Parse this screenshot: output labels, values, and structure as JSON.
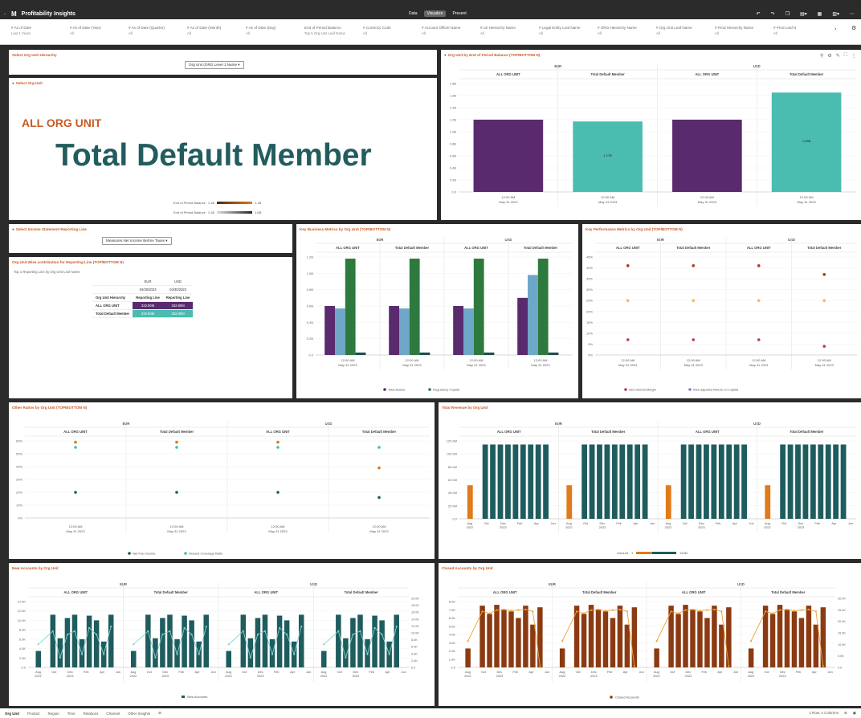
{
  "app": {
    "title": "Profitability Insights",
    "logo": "M",
    "nav_modes": [
      "Data",
      "Visualize",
      "Present"
    ],
    "active_mode": "Visualize"
  },
  "toolbar_icons": [
    "back-icon",
    "undo-icon",
    "redo-icon",
    "bookmark-icon",
    "save-icon",
    "grid-icon",
    "export-icon",
    "menu-icon"
  ],
  "filters": [
    {
      "label": "# As of Date",
      "value": "Last 1 Years"
    },
    {
      "label": "# As of Date (Year)",
      "value": "All"
    },
    {
      "label": "# As of Date (Quarter)",
      "value": "All"
    },
    {
      "label": "# As of Date (Month)",
      "value": "All"
    },
    {
      "label": "# As of Date (Day)",
      "value": "All"
    },
    {
      "label": "End of Period Balance",
      "value": "Top 5 Org Unit Leaf Name"
    },
    {
      "label": "# Currency Code",
      "value": "All"
    },
    {
      "label": "# Account Officer Name",
      "value": "All"
    },
    {
      "label": "# LE Hierarchy Name",
      "value": "All"
    },
    {
      "label": "# Legal Entity Leaf Name",
      "value": "All"
    },
    {
      "label": "# ORG Hierarchy Name",
      "value": "All"
    },
    {
      "label": "# Org Unit Leaf Name",
      "value": "All"
    },
    {
      "label": "# Prod Hierarchy Name",
      "value": "All"
    },
    {
      "label": "# Prod Leaf N",
      "value": "All"
    }
  ],
  "org_hier": {
    "title": "Select Org Unit Hierarchy",
    "select": "Org Unit (ORG Level 1 Name"
  },
  "select_org": {
    "title": "Select Org Unit",
    "parent": "ALL ORG UNIT",
    "member": "Total Default Member",
    "legend": [
      {
        "label": "End of Period Balance",
        "min": "1.1B",
        "max": "1.1B"
      },
      {
        "label": "End of Period Balance",
        "min": "1.1B",
        "max": "1.6B"
      }
    ]
  },
  "reporting_line": {
    "title": "Select Income Statement Reporting Line",
    "select": "Measures.Net Income Before Taxes"
  },
  "contrib": {
    "title": "Org Unit Wise contribution for Reporting Line (TOP/BOTTOM N)",
    "subtitle": "Top 1 Reporting Line by Org Unit Leaf Name",
    "currencies": [
      "EUR",
      "USD"
    ],
    "dates": [
      "04/30/2023",
      "04/30/2023"
    ],
    "header_row": [
      "Org Unit Hierarchy",
      "Reporting Line",
      "Reporting Line"
    ],
    "rows": [
      {
        "name": "ALL ORG UNIT",
        "vals": [
          "332.90M",
          "332.90M"
        ]
      },
      {
        "name": "Total Default Member",
        "vals": [
          "332.90M",
          "332.90M"
        ]
      }
    ]
  },
  "eop": {
    "title": "Org Unit by End of Period Balance (TOP/BOTTOM N)",
    "currencies": [
      "EUR",
      "USD"
    ],
    "columns": [
      "ALL ORG UNIT",
      "Total Default Member",
      "ALL ORG UNIT",
      "Total Default Member"
    ],
    "x_label_1": "12:00 AM",
    "x_label_2": "May 31 2023",
    "y_ticks": [
      "1.8B",
      "1.6B",
      "1.4B",
      "1.2B",
      "1.0B",
      "0.8B",
      "0.6B",
      "0.4B",
      "0.2B",
      "0.0"
    ],
    "bar_labels": [
      "",
      "1.17B",
      "",
      "1.65B"
    ]
  },
  "key_business": {
    "title": "Key Business Metrics by Org Unit (TOP/BOTTOM N)",
    "currencies": [
      "EUR",
      "USD"
    ],
    "columns": [
      "ALL ORG UNIT",
      "Total Default Member",
      "ALL ORG UNIT",
      "Total Default Member"
    ],
    "y_ticks": [
      "1.2B",
      "1.0B",
      "0.8B",
      "0.6B",
      "0.4B",
      "0.2B",
      "0.0"
    ],
    "legend": [
      "Total Assets",
      "Regulatory Capital"
    ]
  },
  "key_perf": {
    "title": "Key Performance Metrics by Org Unit (TOP/BOTTOM N)",
    "currencies": [
      "EUR",
      "USD"
    ],
    "columns": [
      "ALL ORG UNIT",
      "Total Default Member",
      "ALL ORG UNIT",
      "Total Default Member"
    ],
    "y_ticks": [
      "45%",
      "40%",
      "35%",
      "30%",
      "25%",
      "20%",
      "15%",
      "10%",
      "5%",
      "0%"
    ],
    "legend": [
      "Net Interest Margin",
      "Risk adjusted Return on Capital"
    ]
  },
  "other_ratios": {
    "title": "Other Ratios by Org Unit (TOP/BOTTOM N)",
    "currencies": [
      "EUR",
      "USD"
    ],
    "columns": [
      "ALL ORG UNIT",
      "Total Default Member",
      "ALL ORG UNIT",
      "Total Default Member"
    ],
    "y_ticks": [
      "60%",
      "50%",
      "40%",
      "30%",
      "20%",
      "10%",
      "0%"
    ],
    "legend": [
      "Net Fee Income",
      "Interest Coverage Ratio"
    ]
  },
  "revenue": {
    "title": "Total Revenue by Org Unit",
    "currencies": [
      "EUR",
      "USD"
    ],
    "columns": [
      "ALL ORG UNIT",
      "Total Default Member",
      "ALL ORG UNIT",
      "Total Default Member"
    ],
    "y_ticks": [
      "120.0M",
      "100.0M",
      "80.0M",
      "60.0M",
      "40.0M",
      "20.0M",
      "0.0"
    ],
    "x_ticks": [
      "Aug 2022",
      "Oct",
      "Dec 2023",
      "Feb",
      "Apr",
      "Jun"
    ],
    "legend_label": "Amount",
    "legend_min": "1",
    "legend_max": "124M"
  },
  "new_accounts": {
    "title": "New Accounts by Org Unit",
    "currencies": [
      "EUR",
      "USD"
    ],
    "columns": [
      "ALL ORG UNIT",
      "Total Default Member",
      "ALL ORG UNIT",
      "Total Default Member"
    ],
    "y_ticks": [
      "14.0K",
      "12.0K",
      "10.0K",
      "8.0K",
      "6.0K",
      "4.0K",
      "2.0K",
      "0.0"
    ],
    "y2_ticks": [
      "20.0K",
      "18.0K",
      "16.0K",
      "14.0K",
      "12.0K",
      "10.0K",
      "8.0K",
      "6.0K",
      "4.0K",
      "2.0K",
      "0.0"
    ],
    "x_ticks": [
      "Aug 2022",
      "Oct",
      "Dec 2023",
      "Feb",
      "Apr",
      "Jun"
    ],
    "legend": [
      "New Accounts"
    ]
  },
  "closed_accounts": {
    "title": "Closed Accounts by Org Unit",
    "currencies": [
      "EUR",
      "USD"
    ],
    "columns": [
      "ALL ORG UNIT",
      "Total Default Member",
      "ALL ORG UNIT",
      "Total Default Member"
    ],
    "y_ticks": [
      "8.0K",
      "7.0K",
      "6.0K",
      "5.0K",
      "4.0K",
      "3.0K",
      "2.0K",
      "1.0K",
      "0.0"
    ],
    "y2_ticks": [
      "30.0K",
      "25.0K",
      "20.0K",
      "15.0K",
      "10.0K",
      "5.0K",
      "0.0"
    ],
    "x_ticks": [
      "Aug 2022",
      "Oct",
      "Dec 2023",
      "Feb",
      "Apr",
      "Jun"
    ],
    "legend": [
      "Closed Accounts"
    ]
  },
  "bottom_tabs": [
    "Org Unit",
    "Product",
    "Region",
    "Time",
    "Relations",
    "Channel",
    "Other Insights"
  ],
  "bottom_right": "1 Row, 4 Columns",
  "chart_data": [
    {
      "type": "bar",
      "title": "Org Unit by End of Period Balance (TOP/BOTTOM N)",
      "categories": [
        "EUR ALL ORG UNIT",
        "EUR Total Default Member",
        "USD ALL ORG UNIT",
        "USD Total Default Member"
      ],
      "values": [
        1.2,
        1.17,
        1.2,
        1.65
      ],
      "ylim": [
        0,
        1.8
      ]
    },
    {
      "type": "bar",
      "title": "Key Business Metrics by Org Unit (TOP/BOTTOM N)",
      "categories": [
        "EUR ALL ORG UNIT",
        "EUR Total Default Member",
        "USD ALL ORG UNIT",
        "USD Total Default Member"
      ],
      "series": [
        {
          "name": "Total Assets",
          "values": [
            0.6,
            0.6,
            0.6,
            0.7
          ]
        },
        {
          "name": "",
          "values": [
            0.57,
            0.57,
            0.57,
            0.98
          ]
        },
        {
          "name": "Regulatory Capital",
          "values": [
            1.18,
            1.18,
            1.18,
            1.18
          ]
        },
        {
          "name": "",
          "values": [
            0.03,
            0.03,
            0.03,
            0.03
          ]
        }
      ],
      "ylim": [
        0,
        1.2
      ]
    },
    {
      "type": "scatter",
      "title": "Key Performance Metrics by Org Unit (TOP/BOTTOM N)",
      "categories": [
        "EUR ALL ORG UNIT",
        "EUR Total Default Member",
        "USD ALL ORG UNIT",
        "USD Total Default Member"
      ],
      "series": [
        {
          "name": "Net Interest Margin",
          "values": [
            0.07,
            0.07,
            0.07,
            0.04
          ]
        },
        {
          "name": "",
          "values": [
            0.41,
            0.41,
            0.41,
            0.37
          ]
        },
        {
          "name": "Risk adjusted Return on Capital",
          "values": [
            0.25,
            0.25,
            0.25,
            0.25
          ]
        }
      ],
      "ylim": [
        0,
        0.45
      ]
    },
    {
      "type": "scatter",
      "title": "Other Ratios by Org Unit (TOP/BOTTOM N)",
      "categories": [
        "EUR ALL ORG UNIT",
        "EUR Total Default Member",
        "USD ALL ORG UNIT",
        "USD Total Default Member"
      ],
      "series": [
        {
          "name": "Net Fee Income",
          "values": [
            0.2,
            0.2,
            0.2,
            0.16
          ]
        },
        {
          "name": "Interest Coverage Ratio",
          "values": [
            0.55,
            0.55,
            0.55,
            0.55
          ]
        },
        {
          "name": "",
          "values": [
            0.59,
            0.59,
            0.59,
            0.39
          ]
        }
      ],
      "ylim": [
        0,
        0.6
      ]
    },
    {
      "type": "bar",
      "title": "Total Revenue by Org Unit",
      "categories": [
        "Aug 2022",
        "Sep",
        "Oct",
        "Nov",
        "Dec 2023",
        "Jan",
        "Feb",
        "Mar",
        "Apr",
        "May",
        "Jun"
      ],
      "series": [
        {
          "name": "EUR ALL ORG UNIT",
          "values": [
            56,
            0,
            124,
            124,
            124,
            124,
            124,
            124,
            124,
            124,
            124
          ]
        }
      ],
      "ylim": [
        0,
        130
      ]
    },
    {
      "type": "bar",
      "title": "New Accounts by Org Unit",
      "categories": [
        "Aug 2022",
        "Sep",
        "Oct",
        "Nov",
        "Dec 2023",
        "Jan",
        "Feb",
        "Mar",
        "Apr",
        "May",
        "Jun"
      ],
      "series": [
        {
          "name": "New Accounts",
          "values": [
            3.5,
            0,
            11.2,
            6.2,
            10.5,
            11.2,
            6.0,
            11.0,
            10.0,
            5.5,
            11.2
          ]
        }
      ],
      "ylim": [
        0,
        14
      ]
    },
    {
      "type": "bar",
      "title": "Closed Accounts by Org Unit",
      "categories": [
        "Aug 2022",
        "Sep",
        "Oct",
        "Nov",
        "Dec 2023",
        "Jan",
        "Feb",
        "Mar",
        "Apr",
        "May",
        "Jun"
      ],
      "series": [
        {
          "name": "Closed Accounts",
          "values": [
            2.3,
            0,
            7.5,
            6.5,
            7.6,
            7.0,
            6.8,
            6.0,
            7.5,
            5.2,
            7.3
          ]
        }
      ],
      "ylim": [
        0,
        8
      ]
    }
  ]
}
